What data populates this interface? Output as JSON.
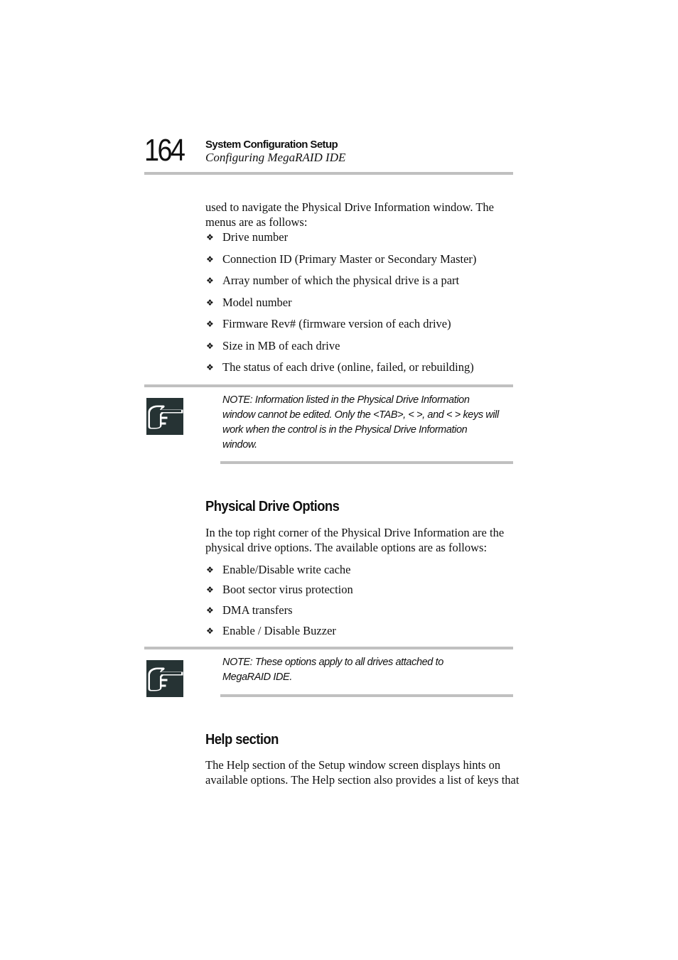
{
  "header": {
    "page_number": "164",
    "chapter_title": "System Configuration Setup",
    "section_title": "Configuring MegaRAID IDE"
  },
  "intro": {
    "text": "used to navigate the Physical Drive Information window.  The menus are as follows:",
    "bullets": [
      "Drive number",
      "Connection ID (Primary Master or Secondary Master)",
      "Array number of which the physical drive is a part",
      "Model number",
      "Firmware Rev# (firmware version of each drive)",
      "Size in MB of each drive",
      "The status of each drive (online, failed, or rebuilding)"
    ]
  },
  "note1": {
    "icon": "pointing-hand-icon",
    "text": "NOTE: Information listed in the Physical Drive Information window cannot be edited.  Only the <TAB>, <   >, and <   > keys will work when the control is in the Physical Drive Information window."
  },
  "physical_drive_options": {
    "heading": "Physical Drive Options",
    "text": "In the top right corner of the Physical Drive Information are the physical drive options.  The available options are as follows:",
    "bullets": [
      "Enable/Disable write cache",
      "Boot sector virus protection",
      "DMA transfers",
      "Enable / Disable Buzzer"
    ]
  },
  "note2": {
    "icon": "pointing-hand-icon",
    "text": "NOTE: These options apply to all drives attached to MegaRAID IDE."
  },
  "help_section": {
    "heading": "Help section",
    "text": "The Help section of the Setup window screen displays hints on available options. The Help section also provides a list of keys that"
  },
  "bullet_glyph": "❖"
}
